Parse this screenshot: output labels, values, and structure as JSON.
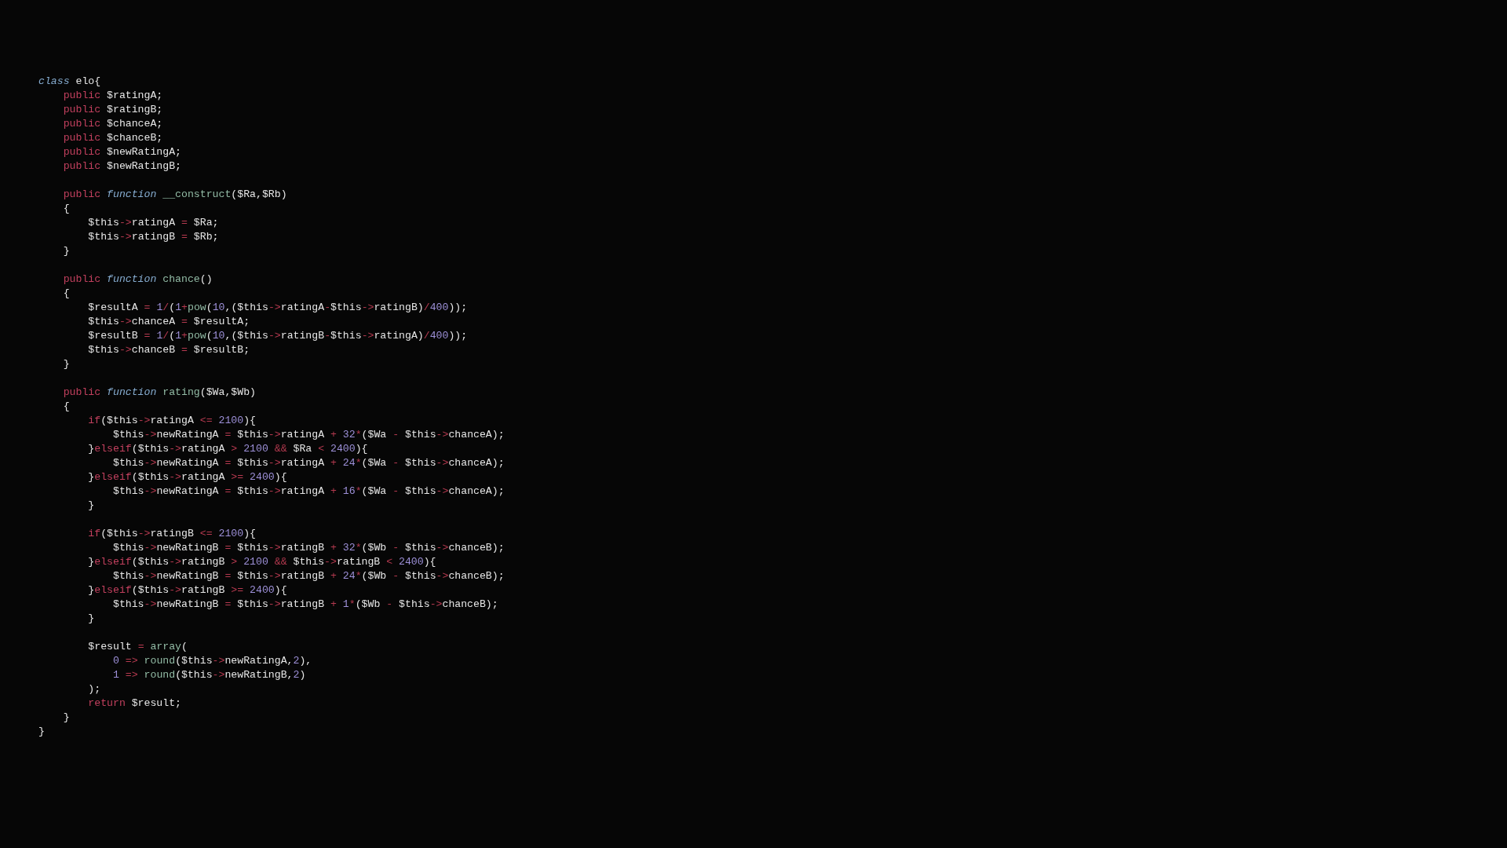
{
  "code_blocks": [
    {
      "lines": [
        [
          {
            "kind": "keyword",
            "text": "class"
          },
          {
            "kind": "text",
            "text": " elo{"
          }
        ],
        [
          {
            "kind": "storage",
            "text": "    public"
          },
          {
            "kind": "text",
            "text": " $ratingA;"
          }
        ],
        [
          {
            "kind": "storage",
            "text": "    public"
          },
          {
            "kind": "text",
            "text": " $ratingB;"
          }
        ],
        [
          {
            "kind": "storage",
            "text": "    public"
          },
          {
            "kind": "text",
            "text": " $chanceA;"
          }
        ],
        [
          {
            "kind": "storage",
            "text": "    public"
          },
          {
            "kind": "text",
            "text": " $chanceB;"
          }
        ],
        [
          {
            "kind": "storage",
            "text": "    public"
          },
          {
            "kind": "text",
            "text": " $newRatingA;"
          }
        ],
        [
          {
            "kind": "storage",
            "text": "    public"
          },
          {
            "kind": "text",
            "text": " $newRatingB;"
          }
        ]
      ]
    },
    {
      "lines": [
        [
          {
            "kind": "storage",
            "text": "    public"
          },
          {
            "kind": "keyword",
            "text": " function"
          },
          {
            "kind": "function",
            "text": " __construct"
          },
          {
            "kind": "text",
            "text": "($Ra,$Rb)"
          }
        ],
        [
          {
            "kind": "text",
            "text": "    {"
          }
        ],
        [
          {
            "kind": "text",
            "text": "        $this"
          },
          {
            "kind": "operator",
            "text": "->"
          },
          {
            "kind": "text",
            "text": "ratingA "
          },
          {
            "kind": "operator",
            "text": "="
          },
          {
            "kind": "text",
            "text": " $Ra;"
          }
        ],
        [
          {
            "kind": "text",
            "text": "        $this"
          },
          {
            "kind": "operator",
            "text": "->"
          },
          {
            "kind": "text",
            "text": "ratingB "
          },
          {
            "kind": "operator",
            "text": "="
          },
          {
            "kind": "text",
            "text": " $Rb;"
          }
        ],
        [
          {
            "kind": "text",
            "text": "    }"
          }
        ]
      ]
    },
    {
      "lines": [
        [
          {
            "kind": "storage",
            "text": "    public"
          },
          {
            "kind": "keyword",
            "text": " function"
          },
          {
            "kind": "function",
            "text": " chance"
          },
          {
            "kind": "text",
            "text": "()"
          }
        ],
        [
          {
            "kind": "text",
            "text": "    {"
          }
        ],
        [
          {
            "kind": "text",
            "text": "        $resultA "
          },
          {
            "kind": "operator",
            "text": "="
          },
          {
            "kind": "number",
            "text": " 1"
          },
          {
            "kind": "operator",
            "text": "/"
          },
          {
            "kind": "text",
            "text": "("
          },
          {
            "kind": "number",
            "text": "1"
          },
          {
            "kind": "operator",
            "text": "+"
          },
          {
            "kind": "function",
            "text": "pow"
          },
          {
            "kind": "text",
            "text": "("
          },
          {
            "kind": "number",
            "text": "10"
          },
          {
            "kind": "text",
            "text": ",($this"
          },
          {
            "kind": "operator",
            "text": "->"
          },
          {
            "kind": "text",
            "text": "ratingA"
          },
          {
            "kind": "operator",
            "text": "-"
          },
          {
            "kind": "text",
            "text": "$this"
          },
          {
            "kind": "operator",
            "text": "->"
          },
          {
            "kind": "text",
            "text": "ratingB)"
          },
          {
            "kind": "operator",
            "text": "/"
          },
          {
            "kind": "number",
            "text": "400"
          },
          {
            "kind": "text",
            "text": "));"
          }
        ],
        [
          {
            "kind": "text",
            "text": "        $this"
          },
          {
            "kind": "operator",
            "text": "->"
          },
          {
            "kind": "text",
            "text": "chanceA "
          },
          {
            "kind": "operator",
            "text": "="
          },
          {
            "kind": "text",
            "text": " $resultA;"
          }
        ],
        [
          {
            "kind": "text",
            "text": "        $resultB "
          },
          {
            "kind": "operator",
            "text": "="
          },
          {
            "kind": "number",
            "text": " 1"
          },
          {
            "kind": "operator",
            "text": "/"
          },
          {
            "kind": "text",
            "text": "("
          },
          {
            "kind": "number",
            "text": "1"
          },
          {
            "kind": "operator",
            "text": "+"
          },
          {
            "kind": "function",
            "text": "pow"
          },
          {
            "kind": "text",
            "text": "("
          },
          {
            "kind": "number",
            "text": "10"
          },
          {
            "kind": "text",
            "text": ",($this"
          },
          {
            "kind": "operator",
            "text": "->"
          },
          {
            "kind": "text",
            "text": "ratingB"
          },
          {
            "kind": "operator",
            "text": "-"
          },
          {
            "kind": "text",
            "text": "$this"
          },
          {
            "kind": "operator",
            "text": "->"
          },
          {
            "kind": "text",
            "text": "ratingA)"
          },
          {
            "kind": "operator",
            "text": "/"
          },
          {
            "kind": "number",
            "text": "400"
          },
          {
            "kind": "text",
            "text": "));"
          }
        ],
        [
          {
            "kind": "text",
            "text": "        $this"
          },
          {
            "kind": "operator",
            "text": "->"
          },
          {
            "kind": "text",
            "text": "chanceB "
          },
          {
            "kind": "operator",
            "text": "="
          },
          {
            "kind": "text",
            "text": " $resultB;"
          }
        ],
        [
          {
            "kind": "text",
            "text": "    }"
          }
        ]
      ]
    },
    {
      "lines": [
        [
          {
            "kind": "storage",
            "text": "    public"
          },
          {
            "kind": "keyword",
            "text": " function"
          },
          {
            "kind": "function",
            "text": " rating"
          },
          {
            "kind": "text",
            "text": "($Wa,$Wb)"
          }
        ],
        [
          {
            "kind": "text",
            "text": "    {"
          }
        ],
        [
          {
            "kind": "storage",
            "text": "        if"
          },
          {
            "kind": "text",
            "text": "($this"
          },
          {
            "kind": "operator",
            "text": "->"
          },
          {
            "kind": "text",
            "text": "ratingA "
          },
          {
            "kind": "operator",
            "text": "<="
          },
          {
            "kind": "number",
            "text": " 2100"
          },
          {
            "kind": "text",
            "text": "){"
          }
        ],
        [
          {
            "kind": "text",
            "text": "            $this"
          },
          {
            "kind": "operator",
            "text": "->"
          },
          {
            "kind": "text",
            "text": "newRatingA "
          },
          {
            "kind": "operator",
            "text": "="
          },
          {
            "kind": "text",
            "text": " $this"
          },
          {
            "kind": "operator",
            "text": "->"
          },
          {
            "kind": "text",
            "text": "ratingA "
          },
          {
            "kind": "operator",
            "text": "+"
          },
          {
            "kind": "number",
            "text": " 32"
          },
          {
            "kind": "operator",
            "text": "*"
          },
          {
            "kind": "text",
            "text": "($Wa "
          },
          {
            "kind": "operator",
            "text": "-"
          },
          {
            "kind": "text",
            "text": " $this"
          },
          {
            "kind": "operator",
            "text": "->"
          },
          {
            "kind": "text",
            "text": "chanceA);"
          }
        ],
        [
          {
            "kind": "text",
            "text": "        }"
          },
          {
            "kind": "storage",
            "text": "elseif"
          },
          {
            "kind": "text",
            "text": "($this"
          },
          {
            "kind": "operator",
            "text": "->"
          },
          {
            "kind": "text",
            "text": "ratingA "
          },
          {
            "kind": "operator",
            "text": ">"
          },
          {
            "kind": "number",
            "text": " 2100 "
          },
          {
            "kind": "operator",
            "text": "&&"
          },
          {
            "kind": "text",
            "text": " $Ra "
          },
          {
            "kind": "operator",
            "text": "<"
          },
          {
            "kind": "number",
            "text": " 2400"
          },
          {
            "kind": "text",
            "text": "){"
          }
        ],
        [
          {
            "kind": "text",
            "text": "            $this"
          },
          {
            "kind": "operator",
            "text": "->"
          },
          {
            "kind": "text",
            "text": "newRatingA "
          },
          {
            "kind": "operator",
            "text": "="
          },
          {
            "kind": "text",
            "text": " $this"
          },
          {
            "kind": "operator",
            "text": "->"
          },
          {
            "kind": "text",
            "text": "ratingA "
          },
          {
            "kind": "operator",
            "text": "+"
          },
          {
            "kind": "number",
            "text": " 24"
          },
          {
            "kind": "operator",
            "text": "*"
          },
          {
            "kind": "text",
            "text": "($Wa "
          },
          {
            "kind": "operator",
            "text": "-"
          },
          {
            "kind": "text",
            "text": " $this"
          },
          {
            "kind": "operator",
            "text": "->"
          },
          {
            "kind": "text",
            "text": "chanceA);"
          }
        ],
        [
          {
            "kind": "text",
            "text": "        }"
          },
          {
            "kind": "storage",
            "text": "elseif"
          },
          {
            "kind": "text",
            "text": "($this"
          },
          {
            "kind": "operator",
            "text": "->"
          },
          {
            "kind": "text",
            "text": "ratingA "
          },
          {
            "kind": "operator",
            "text": ">="
          },
          {
            "kind": "number",
            "text": " 2400"
          },
          {
            "kind": "text",
            "text": "){"
          }
        ],
        [
          {
            "kind": "text",
            "text": "            $this"
          },
          {
            "kind": "operator",
            "text": "->"
          },
          {
            "kind": "text",
            "text": "newRatingA "
          },
          {
            "kind": "operator",
            "text": "="
          },
          {
            "kind": "text",
            "text": " $this"
          },
          {
            "kind": "operator",
            "text": "->"
          },
          {
            "kind": "text",
            "text": "ratingA "
          },
          {
            "kind": "operator",
            "text": "+"
          },
          {
            "kind": "number",
            "text": " 16"
          },
          {
            "kind": "operator",
            "text": "*"
          },
          {
            "kind": "text",
            "text": "($Wa "
          },
          {
            "kind": "operator",
            "text": "-"
          },
          {
            "kind": "text",
            "text": " $this"
          },
          {
            "kind": "operator",
            "text": "->"
          },
          {
            "kind": "text",
            "text": "chanceA);"
          }
        ],
        [
          {
            "kind": "text",
            "text": "        }"
          }
        ]
      ]
    },
    {
      "lines": [
        [
          {
            "kind": "storage",
            "text": "        if"
          },
          {
            "kind": "text",
            "text": "($this"
          },
          {
            "kind": "operator",
            "text": "->"
          },
          {
            "kind": "text",
            "text": "ratingB "
          },
          {
            "kind": "operator",
            "text": "<="
          },
          {
            "kind": "number",
            "text": " 2100"
          },
          {
            "kind": "text",
            "text": "){"
          }
        ],
        [
          {
            "kind": "text",
            "text": "            $this"
          },
          {
            "kind": "operator",
            "text": "->"
          },
          {
            "kind": "text",
            "text": "newRatingB "
          },
          {
            "kind": "operator",
            "text": "="
          },
          {
            "kind": "text",
            "text": " $this"
          },
          {
            "kind": "operator",
            "text": "->"
          },
          {
            "kind": "text",
            "text": "ratingB "
          },
          {
            "kind": "operator",
            "text": "+"
          },
          {
            "kind": "number",
            "text": " 32"
          },
          {
            "kind": "operator",
            "text": "*"
          },
          {
            "kind": "text",
            "text": "($Wb "
          },
          {
            "kind": "operator",
            "text": "-"
          },
          {
            "kind": "text",
            "text": " $this"
          },
          {
            "kind": "operator",
            "text": "->"
          },
          {
            "kind": "text",
            "text": "chanceB);"
          }
        ],
        [
          {
            "kind": "text",
            "text": "        }"
          },
          {
            "kind": "storage",
            "text": "elseif"
          },
          {
            "kind": "text",
            "text": "($this"
          },
          {
            "kind": "operator",
            "text": "->"
          },
          {
            "kind": "text",
            "text": "ratingB "
          },
          {
            "kind": "operator",
            "text": ">"
          },
          {
            "kind": "number",
            "text": " 2100 "
          },
          {
            "kind": "operator",
            "text": "&&"
          },
          {
            "kind": "text",
            "text": " $this"
          },
          {
            "kind": "operator",
            "text": "->"
          },
          {
            "kind": "text",
            "text": "ratingB "
          },
          {
            "kind": "operator",
            "text": "<"
          },
          {
            "kind": "number",
            "text": " 2400"
          },
          {
            "kind": "text",
            "text": "){"
          }
        ],
        [
          {
            "kind": "text",
            "text": "            $this"
          },
          {
            "kind": "operator",
            "text": "->"
          },
          {
            "kind": "text",
            "text": "newRatingB "
          },
          {
            "kind": "operator",
            "text": "="
          },
          {
            "kind": "text",
            "text": " $this"
          },
          {
            "kind": "operator",
            "text": "->"
          },
          {
            "kind": "text",
            "text": "ratingB "
          },
          {
            "kind": "operator",
            "text": "+"
          },
          {
            "kind": "number",
            "text": " 24"
          },
          {
            "kind": "operator",
            "text": "*"
          },
          {
            "kind": "text",
            "text": "($Wb "
          },
          {
            "kind": "operator",
            "text": "-"
          },
          {
            "kind": "text",
            "text": " $this"
          },
          {
            "kind": "operator",
            "text": "->"
          },
          {
            "kind": "text",
            "text": "chanceB);"
          }
        ],
        [
          {
            "kind": "text",
            "text": "        }"
          },
          {
            "kind": "storage",
            "text": "elseif"
          },
          {
            "kind": "text",
            "text": "($this"
          },
          {
            "kind": "operator",
            "text": "->"
          },
          {
            "kind": "text",
            "text": "ratingB "
          },
          {
            "kind": "operator",
            "text": ">="
          },
          {
            "kind": "number",
            "text": " 2400"
          },
          {
            "kind": "text",
            "text": "){"
          }
        ],
        [
          {
            "kind": "text",
            "text": "            $this"
          },
          {
            "kind": "operator",
            "text": "->"
          },
          {
            "kind": "text",
            "text": "newRatingB "
          },
          {
            "kind": "operator",
            "text": "="
          },
          {
            "kind": "text",
            "text": " $this"
          },
          {
            "kind": "operator",
            "text": "->"
          },
          {
            "kind": "text",
            "text": "ratingB "
          },
          {
            "kind": "operator",
            "text": "+"
          },
          {
            "kind": "number",
            "text": " 1"
          },
          {
            "kind": "operator",
            "text": "*"
          },
          {
            "kind": "text",
            "text": "($Wb "
          },
          {
            "kind": "operator",
            "text": "-"
          },
          {
            "kind": "text",
            "text": " $this"
          },
          {
            "kind": "operator",
            "text": "->"
          },
          {
            "kind": "text",
            "text": "chanceB);"
          }
        ],
        [
          {
            "kind": "text",
            "text": "        }"
          }
        ]
      ]
    },
    {
      "lines": [
        [
          {
            "kind": "text",
            "text": "        $result "
          },
          {
            "kind": "operator",
            "text": "="
          },
          {
            "kind": "function",
            "text": " array"
          },
          {
            "kind": "text",
            "text": "("
          }
        ],
        [
          {
            "kind": "number",
            "text": "            0"
          },
          {
            "kind": "operator",
            "text": " =>"
          },
          {
            "kind": "function",
            "text": " round"
          },
          {
            "kind": "text",
            "text": "($this"
          },
          {
            "kind": "operator",
            "text": "->"
          },
          {
            "kind": "text",
            "text": "newRatingA,"
          },
          {
            "kind": "number",
            "text": "2"
          },
          {
            "kind": "text",
            "text": "),"
          }
        ],
        [
          {
            "kind": "number",
            "text": "            1"
          },
          {
            "kind": "operator",
            "text": " =>"
          },
          {
            "kind": "function",
            "text": " round"
          },
          {
            "kind": "text",
            "text": "($this"
          },
          {
            "kind": "operator",
            "text": "->"
          },
          {
            "kind": "text",
            "text": "newRatingB,"
          },
          {
            "kind": "number",
            "text": "2"
          },
          {
            "kind": "text",
            "text": ")"
          }
        ],
        [
          {
            "kind": "text",
            "text": "        );"
          }
        ],
        [
          {
            "kind": "storage",
            "text": "        return"
          },
          {
            "kind": "text",
            "text": " $result;"
          }
        ],
        [
          {
            "kind": "text",
            "text": "    }"
          }
        ],
        [
          {
            "kind": "text",
            "text": "}"
          }
        ]
      ]
    }
  ]
}
